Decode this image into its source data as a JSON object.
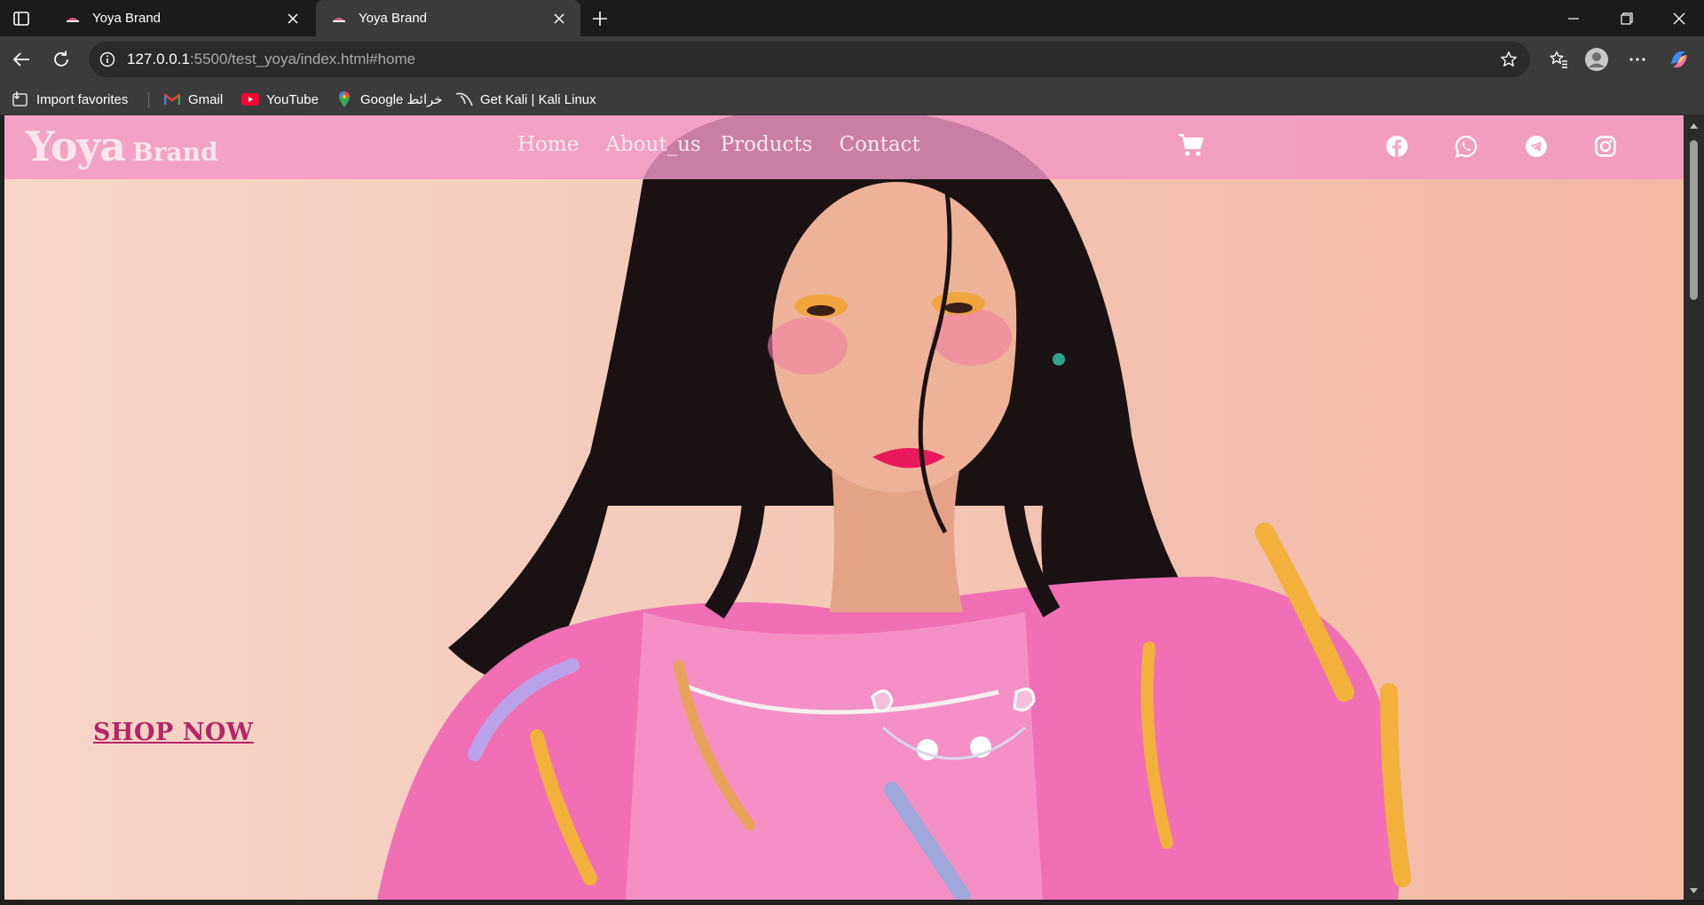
{
  "browser": {
    "tabs": [
      {
        "title": "Yoya Brand",
        "active": false
      },
      {
        "title": "Yoya Brand",
        "active": true
      }
    ],
    "address": {
      "host": "127.0.0.1",
      "path": ":5500/test_yoya/index.html#home"
    },
    "bookmarks": [
      {
        "label": "Import favorites",
        "icon": "import-icon"
      },
      {
        "label": "Gmail",
        "icon": "gmail-icon"
      },
      {
        "label": "YouTube",
        "icon": "youtube-icon"
      },
      {
        "label": "Google خرائط",
        "icon": "google-maps-icon"
      },
      {
        "label": "Get Kali | Kali Linux",
        "icon": "kali-icon"
      }
    ]
  },
  "site": {
    "brand_main": "Yoya",
    "brand_sub": "Brand",
    "nav": [
      "Home",
      "About_us",
      "Products",
      "Contact"
    ],
    "social_icons": [
      "facebook-icon",
      "whatsapp-icon",
      "telegram-icon",
      "instagram-icon"
    ],
    "hero_cta": "SHOP NOW"
  },
  "colors": {
    "nav_bg": "#f196c4",
    "cta": "#b3256a",
    "hero_bg": "#f4cdbd"
  }
}
